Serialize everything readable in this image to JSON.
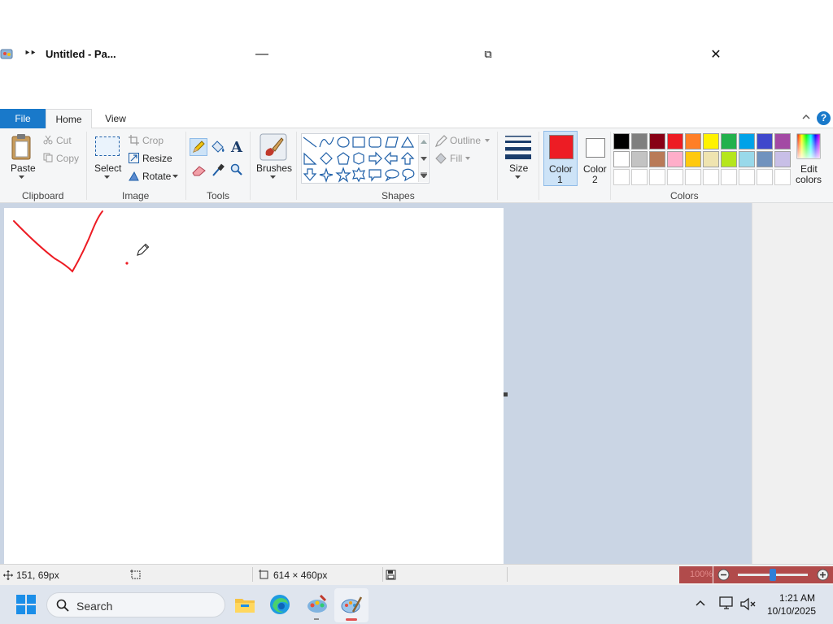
{
  "window": {
    "title": "Untitled - Pa...",
    "quick_access": "‣‣",
    "minimize": "—",
    "restore": "⧉",
    "close": "✕"
  },
  "tabs": [
    {
      "label": "File"
    },
    {
      "label": "Home"
    },
    {
      "label": "View"
    }
  ],
  "help_label": "?",
  "ribbon": {
    "clipboard": {
      "paste": "Paste",
      "cut": "Cut",
      "copy": "Copy",
      "label": "Clipboard"
    },
    "image": {
      "select": "Select",
      "crop": "Crop",
      "resize": "Resize",
      "rotate": "Rotate",
      "label": "Image"
    },
    "tools": {
      "label": "Tools"
    },
    "brushes": {
      "label": "Brushes"
    },
    "shapes": {
      "outline": "Outline",
      "fill": "Fill",
      "label": "Shapes"
    },
    "size": {
      "label": "Size"
    },
    "color1": {
      "label1": "Color",
      "label2": "1",
      "value": "#ed1c24"
    },
    "color2": {
      "label1": "Color",
      "label2": "2",
      "value": "#ffffff"
    },
    "edit_colors": {
      "label1": "Edit",
      "label2": "colors"
    },
    "colors_label": "Colors",
    "palette_row1": [
      "#000000",
      "#7f7f7f",
      "#880015",
      "#ed1c24",
      "#ff7f27",
      "#fff200",
      "#22b14c",
      "#00a2e8",
      "#3f48cc",
      "#a349a4"
    ],
    "palette_row2": [
      "#ffffff",
      "#c3c3c3",
      "#b97a57",
      "#ffaec9",
      "#ffc90e",
      "#efe4b0",
      "#b5e61d",
      "#99d9ea",
      "#7092be",
      "#c8bfe7"
    ],
    "palette_row3": [
      "#ffffff",
      "#ffffff",
      "#ffffff",
      "#ffffff",
      "#ffffff",
      "#ffffff",
      "#ffffff",
      "#ffffff",
      "#ffffff",
      "#ffffff"
    ]
  },
  "status": {
    "cursor_pos": "151, 69px",
    "canvas_size": "614 × 460px",
    "zoom": "100%"
  },
  "taskbar": {
    "search_placeholder": "Search",
    "time": "1:21 AM",
    "date": "10/10/2025"
  }
}
